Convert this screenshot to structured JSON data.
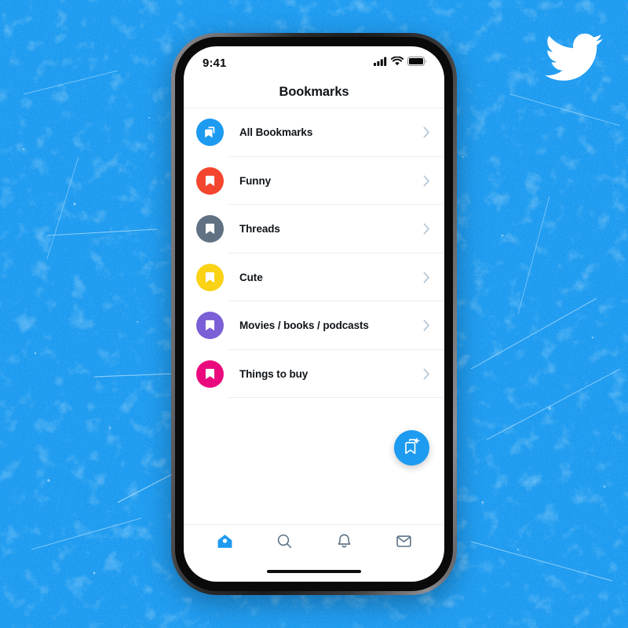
{
  "background": {
    "color": "#1d9bf0",
    "texture": "grunge-scratches"
  },
  "brand": {
    "logo_icon": "twitter-bird-icon",
    "logo_color": "#ffffff",
    "accent_color": "#1d9bf0"
  },
  "phone": {
    "frame_color": "#1c1c1e",
    "screen_background": "#ffffff"
  },
  "status_bar": {
    "time": "9:41",
    "signal_icon": "cellular-signal-icon",
    "wifi_icon": "wifi-icon",
    "battery_icon": "battery-icon"
  },
  "header": {
    "title": "Bookmarks"
  },
  "bookmark_list": {
    "items": [
      {
        "label": "All Bookmarks",
        "color": "#1d9bf0",
        "icon": "bookmarks-stack-icon",
        "chevron": "chevron-right-icon"
      },
      {
        "label": "Funny",
        "color": "#f4452e",
        "icon": "bookmark-icon",
        "chevron": "chevron-right-icon"
      },
      {
        "label": "Threads",
        "color": "#5f7183",
        "icon": "bookmark-icon",
        "chevron": "chevron-right-icon"
      },
      {
        "label": "Cute",
        "color": "#fad216",
        "icon": "bookmark-icon",
        "chevron": "chevron-right-icon"
      },
      {
        "label": "Movies / books / podcasts",
        "color": "#7b5fd6",
        "icon": "bookmark-icon",
        "chevron": "chevron-right-icon"
      },
      {
        "label": "Things to buy",
        "color": "#ea0a7e",
        "icon": "bookmark-icon",
        "chevron": "chevron-right-icon"
      }
    ]
  },
  "fab": {
    "icon": "add-bookmark-icon",
    "color": "#1d9bf0",
    "label": "Create new bookmark folder"
  },
  "bottom_nav": {
    "items": [
      {
        "icon": "home-icon",
        "label": "Home",
        "active": true
      },
      {
        "icon": "search-icon",
        "label": "Search",
        "active": false
      },
      {
        "icon": "notifications-icon",
        "label": "Notifications",
        "active": false
      },
      {
        "icon": "messages-icon",
        "label": "Messages",
        "active": false
      }
    ],
    "active_color": "#1d9bf0",
    "inactive_color": "#5b7083"
  },
  "home_indicator": {
    "present": true
  }
}
